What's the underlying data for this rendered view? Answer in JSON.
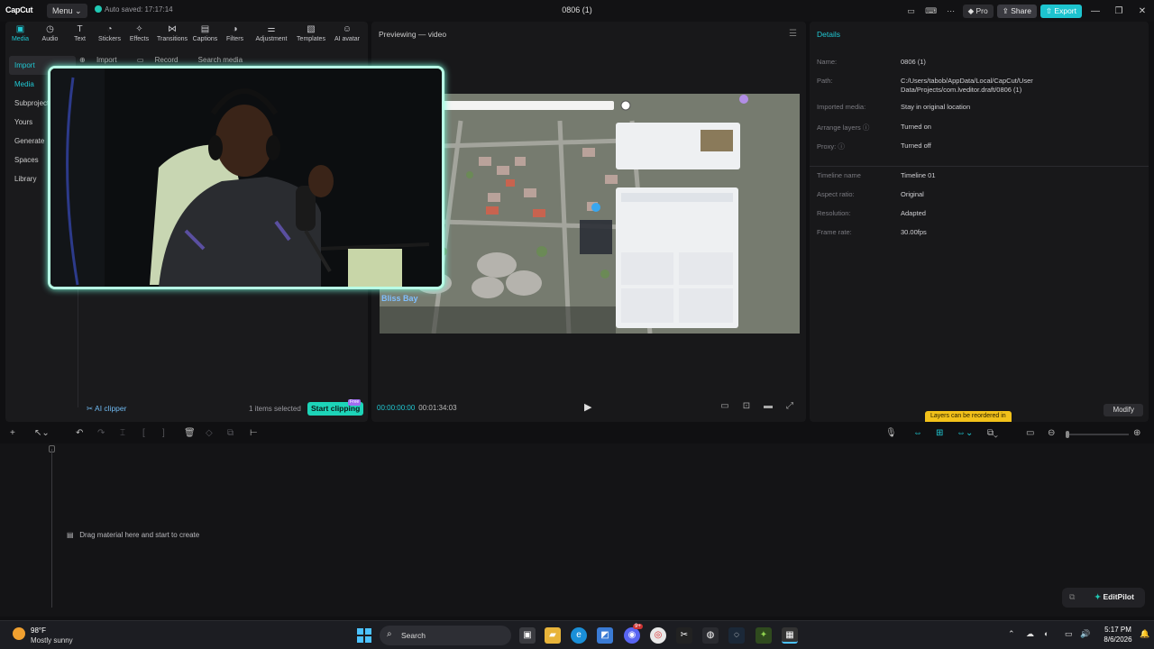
{
  "titlebar": {
    "logo": "CapCut",
    "menu_label": "Menu",
    "autosave": "Auto saved: 17:17:14",
    "project_title": "0806 (1)",
    "pro_label": "Pro",
    "share_label": "Share",
    "export_label": "Export"
  },
  "toolbar": {
    "items": [
      {
        "label": "Media",
        "icon": "media-icon"
      },
      {
        "label": "Audio",
        "icon": "audio-icon"
      },
      {
        "label": "Text",
        "icon": "text-icon"
      },
      {
        "label": "Stickers",
        "icon": "stickers-icon"
      },
      {
        "label": "Effects",
        "icon": "effects-icon"
      },
      {
        "label": "Transitions",
        "icon": "transitions-icon"
      },
      {
        "label": "Captions",
        "icon": "captions-icon"
      },
      {
        "label": "Filters",
        "icon": "filters-icon"
      },
      {
        "label": "Adjustment",
        "icon": "adjustment-icon"
      },
      {
        "label": "Templates",
        "icon": "templates-icon"
      },
      {
        "label": "AI avatar",
        "icon": "ai-avatar-icon"
      }
    ]
  },
  "sidebar": {
    "items": [
      "Import",
      "Media",
      "Subprojects",
      "Yours",
      "Generate",
      "Spaces",
      "Library"
    ]
  },
  "media_header": {
    "import": "Import",
    "record": "Record",
    "search_placeholder": "Search media"
  },
  "media_footer": {
    "ai_clipper": "AI clipper",
    "items_selected": "1 items selected",
    "start_clipping": "Start clipping",
    "badge": "Free"
  },
  "preview": {
    "title": "Previewing — video",
    "current_time": "00:00:00:00",
    "total_time": "00:01:34:03",
    "video_caption_title": "Bliss Bay"
  },
  "details": {
    "title": "Details",
    "rows": [
      {
        "key": "Name:",
        "value": "0806 (1)"
      },
      {
        "key": "Path:",
        "value": "C:/Users/tabob/AppData/Local/CapCut/User Data/Projects/com.lveditor.draft/0806 (1)"
      },
      {
        "key": "Imported media:",
        "value": "Stay in original location"
      },
      {
        "key": "Arrange layers",
        "value": "Turned on"
      },
      {
        "key": "Proxy:",
        "value": "Turned off"
      },
      {
        "key": "Timeline name",
        "value": "Timeline 01"
      },
      {
        "key": "Aspect ratio:",
        "value": "Original"
      },
      {
        "key": "Resolution:",
        "value": "Adapted"
      },
      {
        "key": "Frame rate:",
        "value": "30.00fps"
      }
    ],
    "layers_tip": "Layers can be reordered in",
    "modify_label": "Modify"
  },
  "timeline": {
    "drag_hint": "Drag material here and start to create",
    "editpilot": "EditPilot"
  },
  "taskbar": {
    "temperature": "98°F",
    "condition": "Mostly sunny",
    "search_label": "Search",
    "time": "5:17 PM",
    "date": "8/6/2026",
    "notification_badge": "9+"
  },
  "colors": {
    "accent": "#20c9d4",
    "export": "#1dc4cf",
    "start_clipping": "#1dd4b8",
    "webcam_border": "#b8ffe6",
    "tip": "#f2c11a"
  }
}
